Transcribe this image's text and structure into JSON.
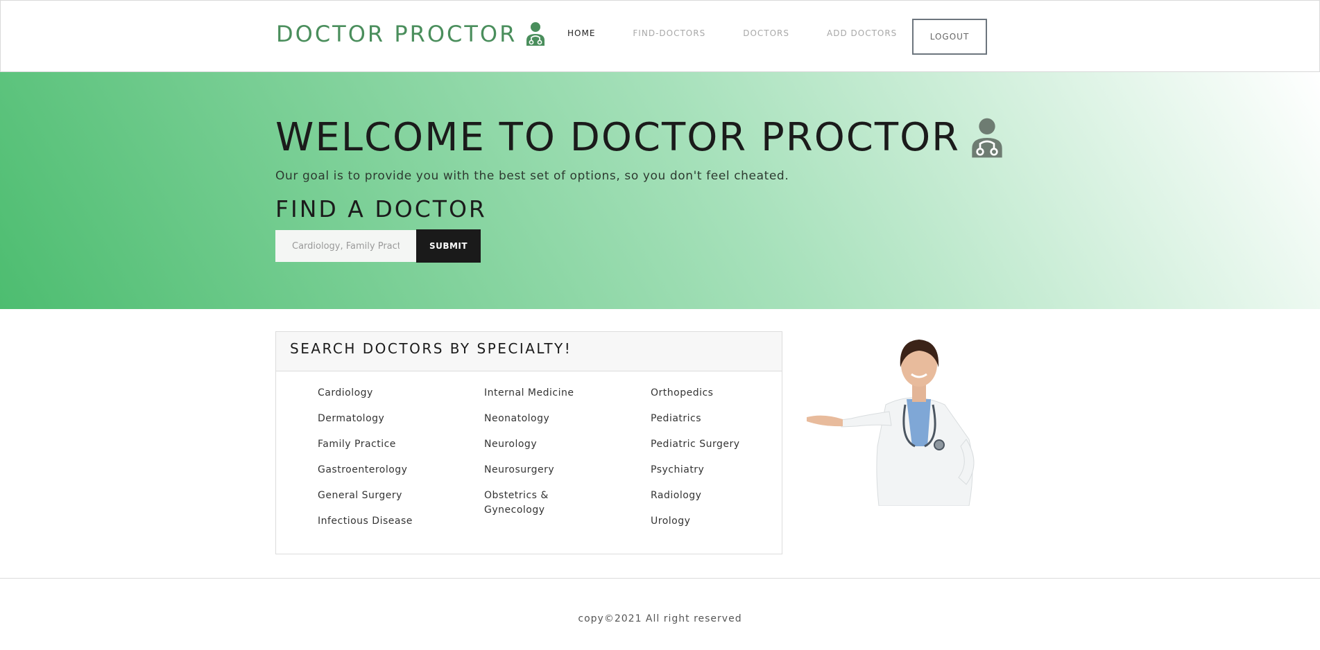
{
  "navbar": {
    "brand": "DOCTOR PROCTOR",
    "brand_icon": "doctor-stethoscope-icon",
    "links": [
      {
        "label": "HOME",
        "active": true
      },
      {
        "label": "FIND-DOCTORS",
        "active": false
      },
      {
        "label": "DOCTORS",
        "active": false
      },
      {
        "label": "ADD DOCTORS",
        "active": false
      }
    ],
    "logout_label": "LOGOUT"
  },
  "hero": {
    "title": "WELCOME TO DOCTOR PROCTOR",
    "subtitle": "Our goal is to provide you with the best set of options, so you don't feel cheated.",
    "find_title": "FIND A DOCTOR",
    "search_placeholder": "Cardiology, Family Practice",
    "submit_label": "SUBMIT"
  },
  "specialties": {
    "title": "SEARCH DOCTORS BY SPECIALTY!",
    "columns": [
      [
        "Cardiology",
        "Dermatology",
        "Family Practice",
        "Gastroenterology",
        "General Surgery",
        "Infectious Disease"
      ],
      [
        "Internal Medicine",
        "Neonatology",
        "Neurology",
        "Neurosurgery",
        "Obstetrics & Gynecology"
      ],
      [
        "Orthopedics",
        "Pediatrics",
        "Pediatric Surgery",
        "Psychiatry",
        "Radiology",
        "Urology"
      ]
    ]
  },
  "footer": {
    "text": "copy©2021 All right reserved"
  },
  "colors": {
    "brand": "#4a8e5c",
    "hero_gradient_start": "#4dbd70",
    "hero_gradient_mid": "#a7e1bb",
    "dark": "#1a1a1a",
    "icon_gray": "#6e7c72"
  }
}
